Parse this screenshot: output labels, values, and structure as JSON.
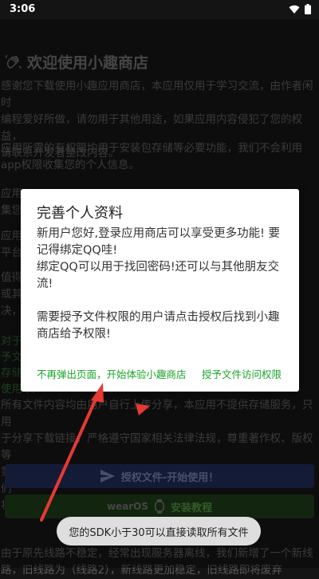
{
  "status_bar": {
    "time": "3:06",
    "icons": [
      "wifi-icon",
      "battery-icon"
    ]
  },
  "welcome": {
    "title": "欢迎使用小趣商店",
    "icon": "waving-hand-icon",
    "paragraphs": [
      "感谢您下载使用小趣应用商店，本应用仅用于学习交流，由作者闲时\n编程爱好所做，请勿用于其他用途，如果应用内容侵犯了您的权益，\n请联系开发者整改内容。",
      "应用所需的有权限均用于安装包存储等必要功能，我们不会利用\napp权限收集您的个人信息。",
      "应用\n集您",
      "应用\n平台",
      "值得                                                                                      os\n或其                                                                                      程解\n决，",
      "对于                                                                                      授\n予文                                                                                      上常\n存储                                                                                      ，\n使用                                                                                  务！",
      "所有文件内容均由用户自行上传分享，本应用不提供存储服务，只用\n于分享下载链接，严格遵守国家相关法律法规，尊重著作权、版权等\n第三方权利，如果当前文件侵犯了您的相关权利，请联系我们，我们\n将及时处理。",
      "由于原先线路不稳定，经常出现服务器离线，我们新增了一个新线\n路，旧线路为（线路2），新线路更加稳定，旧线路即将废弃"
    ],
    "auth_button": "授权文件-开始使用！",
    "install_button": "安装教程",
    "wearos_label": "wearOS"
  },
  "dialog": {
    "title": "完善个人资料",
    "message": "新用户您好,登录应用商店可以享受更多功能! 要\n记得绑定QQ哇!\n绑定QQ可以用于找回密码!还可以与其他朋友交\n流!\n\n需要授予文件权限的用户请点击授权后找到小趣\n商店给予权限!",
    "skip_button": "不再弹出页面，开始体验小趣商店",
    "grant_button": "授予文件访问权限"
  },
  "toast": {
    "text": "您的SDK小于30可以直接读取所有文件"
  },
  "colors": {
    "accent_green": "#1aa32a",
    "arrow_red": "#e53935"
  }
}
